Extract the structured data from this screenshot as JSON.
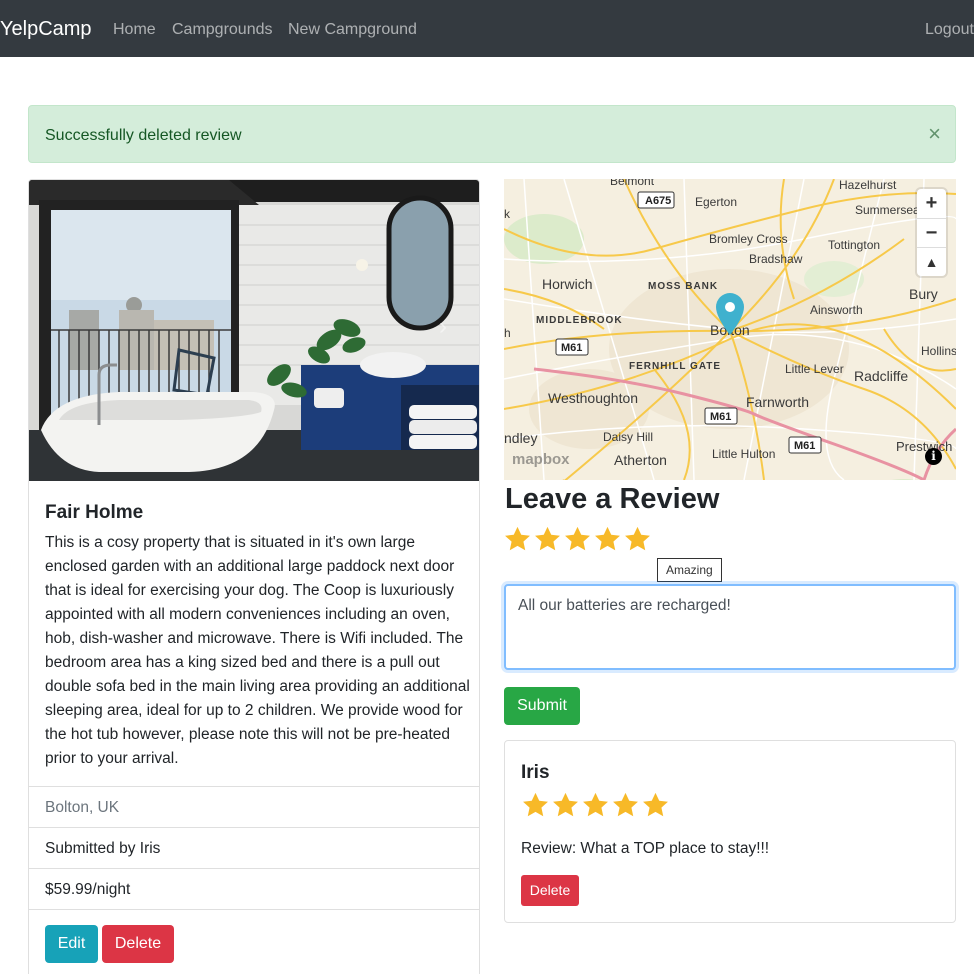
{
  "navbar": {
    "brand": "YelpCamp",
    "links": [
      "Home",
      "Campgrounds",
      "New Campground"
    ],
    "logout": "Logout",
    "bg_color": "#343a40"
  },
  "alert": {
    "message": "Successfully deleted review",
    "close": "×",
    "bg_color": "#d4edda"
  },
  "campground": {
    "title": "Fair Holme",
    "description": "This is a cosy property that is situated in it's own large enclosed garden with an additional large paddock next door that is ideal for exercising your dog. The Coop is luxuriously appointed with all modern conveniences including an oven, hob, dish-washer and microwave. There is Wifi included. The bedroom area has a king sized bed and there is a pull out double sofa bed in the main living area providing an additional sleeping area, ideal for up to 2 children. We provide wood for the hot tub however, please note this will not be pre-heated prior to your arrival.",
    "location": "Bolton, UK",
    "submitted_by": "Submitted by Iris",
    "price": "$59.99/night",
    "edit_label": "Edit",
    "delete_label": "Delete",
    "carousel_prev": "‹",
    "carousel_next": "›"
  },
  "map": {
    "zoom_in": "+",
    "zoom_out": "−",
    "compass": "▲",
    "attribution_logo": "mapbox",
    "info": "i",
    "places": [
      "Belmont",
      "Hazelhurst",
      "Egerton",
      "Summerseat",
      "Bromley Cross",
      "Tottington",
      "Bradshaw",
      "Horwich",
      "MOSS BANK",
      "Bury",
      "MIDDLEBROOK",
      "Ainsworth",
      "Bolton",
      "Hollins",
      "FERNHILL GATE",
      "Little Lever",
      "Radcliffe",
      "Westhoughton",
      "Farnworth",
      "Daisy Hill",
      "Atherton",
      "Little Hulton",
      "Prestwich",
      "ndley",
      "k",
      "h"
    ],
    "roads": [
      "A675",
      "M61",
      "M61",
      "M61"
    ],
    "pin_color": "#3fb1ce"
  },
  "review_form": {
    "heading": "Leave a Review",
    "rating": 5,
    "rating_tooltip": "Amazing",
    "body_value": "All our batteries are recharged!",
    "submit_label": "Submit"
  },
  "reviews": [
    {
      "author": "Iris",
      "rating": 5,
      "body": "Review: What a TOP place to stay!!!",
      "delete_label": "Delete"
    }
  ],
  "colors": {
    "star": "#f7b928",
    "success": "#28a745",
    "danger": "#dc3545",
    "info": "#17a2b8"
  }
}
